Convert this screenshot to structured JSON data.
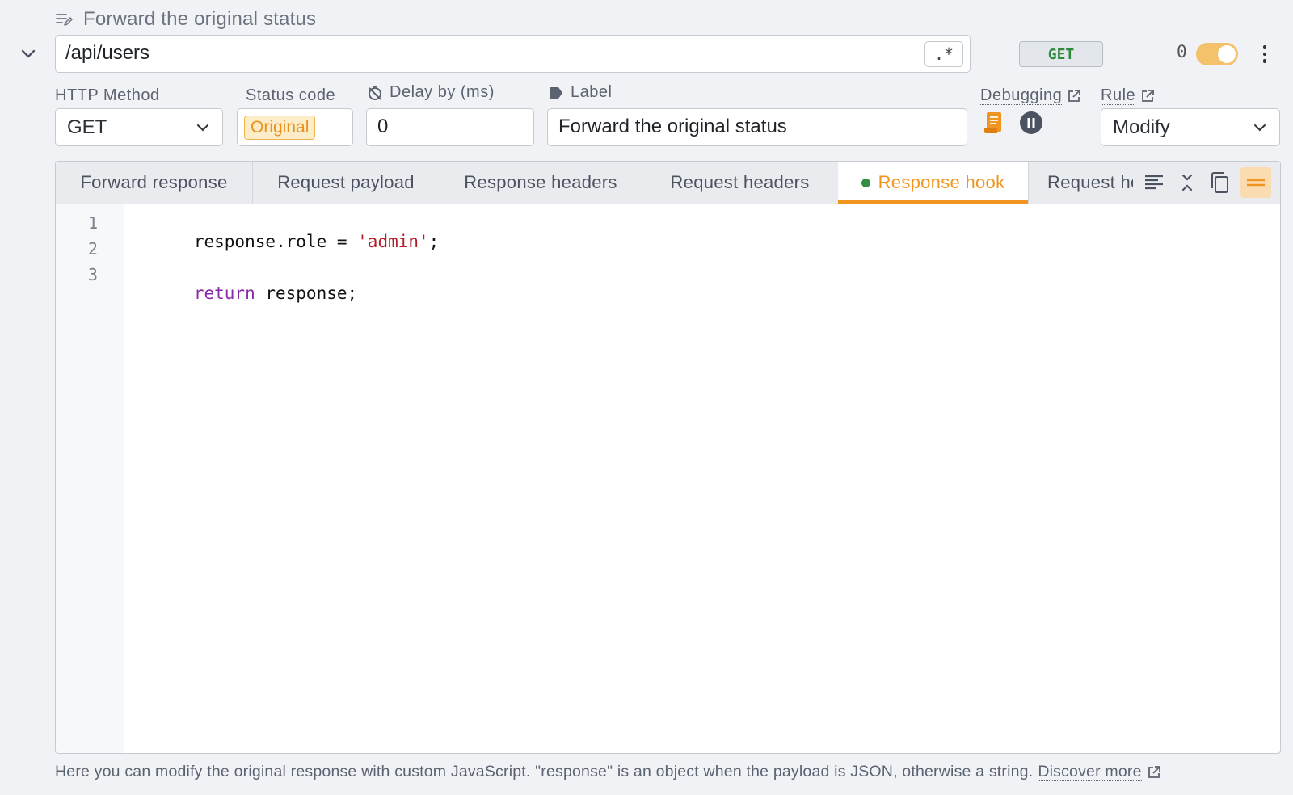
{
  "header": {
    "title": "Forward the original status"
  },
  "matcher": {
    "url": "/api/users",
    "regex_label": ".*",
    "method_badge": "GET",
    "hit_count": "0",
    "enabled": true
  },
  "fields": {
    "http_method": {
      "label": "HTTP Method",
      "value": "GET"
    },
    "status_code": {
      "label": "Status code",
      "value": "Original"
    },
    "delay": {
      "label": "Delay by (ms)",
      "value": "0"
    },
    "label": {
      "label": "Label",
      "value": "Forward the original status"
    },
    "debugging": {
      "label": "Debugging"
    },
    "rule": {
      "label": "Rule",
      "value": "Modify"
    }
  },
  "tabs": [
    {
      "label": "Forward response",
      "active": false
    },
    {
      "label": "Request payload",
      "active": false
    },
    {
      "label": "Response headers",
      "active": false
    },
    {
      "label": "Request headers",
      "active": false
    },
    {
      "label": "Response hook",
      "active": true,
      "indicator": "#2f8f43"
    },
    {
      "label": "Request hook",
      "active": false
    }
  ],
  "editor": {
    "line_numbers": [
      "1",
      "2",
      "3"
    ],
    "lines": [
      {
        "parts": [
          {
            "text": "response.role = ",
            "cls": ""
          },
          {
            "text": "'admin'",
            "cls": "str"
          },
          {
            "text": ";",
            "cls": ""
          }
        ]
      },
      {
        "parts": []
      },
      {
        "parts": [
          {
            "text": "return",
            "cls": "kw"
          },
          {
            "text": " response;",
            "cls": ""
          }
        ]
      }
    ]
  },
  "footer": {
    "text": "Here you can modify the original response with custom JavaScript. \"response\" is an object when the payload is JSON, otherwise a string.",
    "link": "Discover more"
  },
  "colors": {
    "accent": "#f0951f",
    "method_green": "#2e8b3e",
    "toggle_on": "#f3c26a"
  },
  "icons": [
    "edit-note-icon",
    "chevron-down-icon",
    "external-link-icon",
    "timer-off-icon",
    "tag-icon",
    "receipt-icon",
    "pause-icon",
    "align-left-icon",
    "collapse-icon",
    "copy-icon",
    "drag-handle-icon"
  ]
}
